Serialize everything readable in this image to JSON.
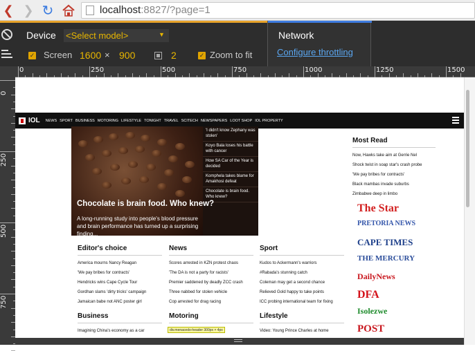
{
  "browser": {
    "url_host": "localhost",
    "url_rest": ":8827/?page=1"
  },
  "devtools": {
    "device_label": "Device",
    "device_select": "<Select model>",
    "screen_label": "Screen",
    "width": "1600",
    "times": "×",
    "height": "900",
    "dpr": "2",
    "zoom_label": "Zoom to fit",
    "network_label": "Network",
    "throttling_link": "Configure throttling"
  },
  "ruler": {
    "h_labels": [
      "0",
      "250",
      "500",
      "750",
      "1000",
      "1250",
      "1500"
    ],
    "v_labels": [
      "0",
      "250",
      "500",
      "750"
    ]
  },
  "site": {
    "logo": "IOL",
    "nav": [
      "NEWS",
      "SPORT",
      "BUSINESS",
      "MOTORING",
      "LIFESTYLE",
      "TONIGHT",
      "TRAVEL",
      "SCITECH",
      "NEWSPAPERS",
      "LOOT SHOP",
      "IOL PROPERTY"
    ],
    "hero": {
      "title": "Chocolate is brain food. Who knew?",
      "desc": "A long-running study into people's blood pressure and brain performance has turned up a surprising finding...",
      "side": [
        "'I didn't know Zephany was stolen'",
        "Koyo Bala loses his battle with cancer",
        "How SA Car of the Year is decided",
        "Komphela takes blame for Amakhosi defeat",
        "Chocolate is brain food. Who knew?"
      ]
    },
    "editors_choice": {
      "title": "Editor's choice",
      "items": [
        "America mourns Nancy Reagan",
        "'We pay bribes for contracts'",
        "Hendricks wins Cape Cycle Tour",
        "Gordhan slams 'dirty tricks' campaign",
        "Jamaican babe not ANC poster girl"
      ]
    },
    "news": {
      "title": "News",
      "items": [
        "Scores arrested in KZN protest chaos",
        "'The DA is not a party for racists'",
        "Premier saddened by deadly ZCC crash",
        "Three nabbed for stolen vehicle",
        "Cop arrested for drag racing"
      ]
    },
    "sport": {
      "title": "Sport",
      "items": [
        "Kudos to Ackermann's warriors",
        "#Rabada's stunning catch",
        "Coleman may get a second chance",
        "Relieved Gold happy to take points",
        "ICC probing international team for fixing"
      ]
    },
    "business": {
      "title": "Business",
      "items": [
        "Imagining China's economy as a car"
      ]
    },
    "motoring": {
      "title": "Motoring",
      "items": [
        ""
      ]
    },
    "lifestyle": {
      "title": "Lifestyle",
      "items": [
        "Video: Young Prince Charles at home"
      ]
    },
    "most_read": {
      "title": "Most Read",
      "items": [
        "Now, Hawks take aim at Gerrie Nel",
        "Shock twist in soap star's crash probe",
        "'We pay bribes for contracts'",
        "Black mambas invade suburbs",
        "Zimbabwe deep in limbo"
      ]
    },
    "newspapers": [
      {
        "name": "The Star",
        "color": "#d21f1f"
      },
      {
        "name": "PRETORIA NEWS",
        "color": "#3355aa"
      },
      {
        "name": "CAPE TIMES",
        "color": "#1d3f8a"
      },
      {
        "name": "THE MERCURY",
        "color": "#2a4c9a"
      },
      {
        "name": "DailyNews",
        "color": "#c8161d"
      },
      {
        "name": "DFA",
        "color": "#d4121a"
      },
      {
        "name": "Isolezwe",
        "color": "#1c8a2a"
      },
      {
        "name": "POST",
        "color": "#c8161d"
      }
    ],
    "tooltip": "div.menacedo-header 300px × 4px"
  }
}
